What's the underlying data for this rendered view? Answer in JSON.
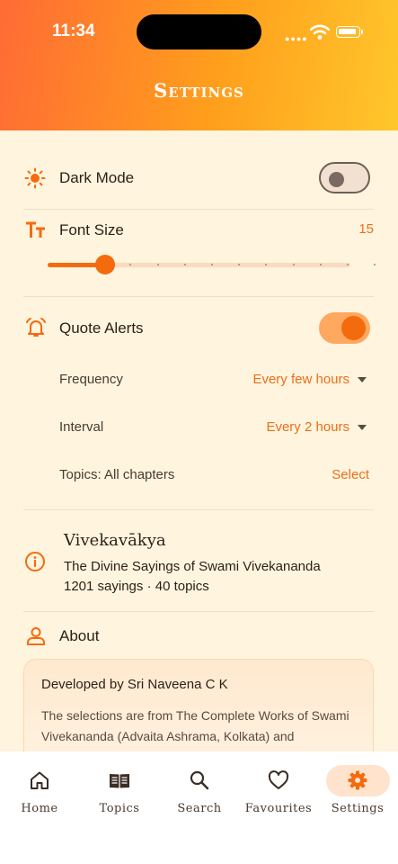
{
  "status_bar": {
    "time": "11:34"
  },
  "header": {
    "title": "Settings"
  },
  "settings": {
    "dark_mode": {
      "label": "Dark Mode",
      "enabled": false
    },
    "font_size": {
      "label": "Font Size",
      "value": "15",
      "slider_fraction": 0.19
    },
    "quote_alerts": {
      "label": "Quote Alerts",
      "enabled": true,
      "frequency": {
        "label": "Frequency",
        "value": "Every few hours"
      },
      "interval": {
        "label": "Interval",
        "value": "Every 2 hours"
      },
      "topics": {
        "label": "Topics: All chapters",
        "action": "Select"
      }
    },
    "app_info": {
      "name": "Vivekavākya",
      "subtitle": "The Divine Sayings of Swami Vivekananda",
      "stats": "1201 sayings · 40 topics"
    },
    "about": {
      "label": "About",
      "card_title": "Developed by Sri Naveena C K",
      "card_text": "The selections are from The Complete Works of Swami Vivekananda (Advaita Ashrama, Kolkata) and"
    }
  },
  "nav": {
    "items": [
      {
        "label": "Home",
        "icon": "home-icon"
      },
      {
        "label": "Topics",
        "icon": "book-icon"
      },
      {
        "label": "Search",
        "icon": "search-icon"
      },
      {
        "label": "Favourites",
        "icon": "heart-icon"
      },
      {
        "label": "Settings",
        "icon": "gear-icon",
        "active": true
      }
    ]
  },
  "colors": {
    "accent": "#f46b0d",
    "background": "#fff4de"
  }
}
